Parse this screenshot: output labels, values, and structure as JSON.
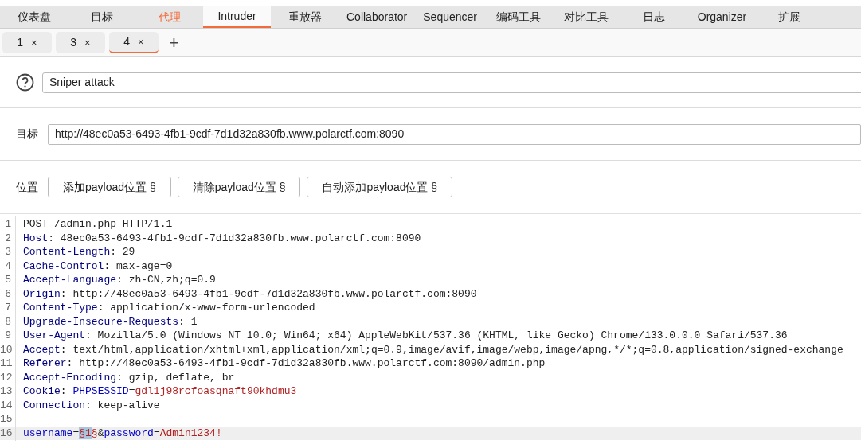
{
  "main_tabs": [
    {
      "label": "仪表盘",
      "selected": false,
      "highlighted": false
    },
    {
      "label": "目标",
      "selected": false,
      "highlighted": false
    },
    {
      "label": "代理",
      "selected": false,
      "highlighted": true
    },
    {
      "label": "Intruder",
      "selected": true,
      "highlighted": false
    },
    {
      "label": "重放器",
      "selected": false,
      "highlighted": false
    },
    {
      "label": "Collaborator",
      "selected": false,
      "highlighted": false
    },
    {
      "label": "Sequencer",
      "selected": false,
      "highlighted": false
    },
    {
      "label": "编码工具",
      "selected": false,
      "highlighted": false
    },
    {
      "label": "对比工具",
      "selected": false,
      "highlighted": false
    },
    {
      "label": "日志",
      "selected": false,
      "highlighted": false
    },
    {
      "label": "Organizer",
      "selected": false,
      "highlighted": false
    },
    {
      "label": "扩展",
      "selected": false,
      "highlighted": false
    }
  ],
  "attack_tabs": [
    {
      "label": "1",
      "close": "×",
      "selected": false
    },
    {
      "label": "3",
      "close": "×",
      "selected": false
    },
    {
      "label": "4",
      "close": "×",
      "selected": true
    }
  ],
  "add_tab": "+",
  "attack_type": {
    "value": "Sniper attack"
  },
  "target": {
    "label": "目标",
    "value": "http://48ec0a53-6493-4fb1-9cdf-7d1d32a830fb.www.polarctf.com:8090"
  },
  "positions": {
    "label": "位置",
    "buttons": [
      "添加payload位置 §",
      "清除payload位置 §",
      "自动添加payload位置 §"
    ]
  },
  "editor_lines": [
    {
      "number": "1",
      "current": false,
      "segments": [
        {
          "kind": "plain",
          "text": "POST /admin.php HTTP/1.1"
        }
      ]
    },
    {
      "number": "2",
      "current": false,
      "segments": [
        {
          "kind": "key",
          "text": "Host"
        },
        {
          "kind": "plain",
          "text": ": 48ec0a53-6493-4fb1-9cdf-7d1d32a830fb.www.polarctf.com:8090"
        }
      ]
    },
    {
      "number": "3",
      "current": false,
      "segments": [
        {
          "kind": "key",
          "text": "Content-Length"
        },
        {
          "kind": "plain",
          "text": ": 29"
        }
      ]
    },
    {
      "number": "4",
      "current": false,
      "segments": [
        {
          "kind": "key",
          "text": "Cache-Control"
        },
        {
          "kind": "plain",
          "text": ": max-age=0"
        }
      ]
    },
    {
      "number": "5",
      "current": false,
      "segments": [
        {
          "kind": "key",
          "text": "Accept-Language"
        },
        {
          "kind": "plain",
          "text": ": zh-CN,zh;q=0.9"
        }
      ]
    },
    {
      "number": "6",
      "current": false,
      "segments": [
        {
          "kind": "key",
          "text": "Origin"
        },
        {
          "kind": "plain",
          "text": ": http://48ec0a53-6493-4fb1-9cdf-7d1d32a830fb.www.polarctf.com:8090"
        }
      ]
    },
    {
      "number": "7",
      "current": false,
      "segments": [
        {
          "kind": "key",
          "text": "Content-Type"
        },
        {
          "kind": "plain",
          "text": ": application/x-www-form-urlencoded"
        }
      ]
    },
    {
      "number": "8",
      "current": false,
      "segments": [
        {
          "kind": "key",
          "text": "Upgrade-Insecure-Requests"
        },
        {
          "kind": "plain",
          "text": ": 1"
        }
      ]
    },
    {
      "number": "9",
      "current": false,
      "segments": [
        {
          "kind": "key",
          "text": "User-Agent"
        },
        {
          "kind": "plain",
          "text": ": Mozilla/5.0 (Windows NT 10.0; Win64; x64) AppleWebKit/537.36 (KHTML, like Gecko) Chrome/133.0.0.0 Safari/537.36"
        }
      ]
    },
    {
      "number": "10",
      "current": false,
      "segments": [
        {
          "kind": "key",
          "text": "Accept"
        },
        {
          "kind": "plain",
          "text": ": text/html,application/xhtml+xml,application/xml;q=0.9,image/avif,image/webp,image/apng,*/*;q=0.8,application/signed-exchange"
        }
      ]
    },
    {
      "number": "11",
      "current": false,
      "segments": [
        {
          "kind": "key",
          "text": "Referer"
        },
        {
          "kind": "plain",
          "text": ": http://48ec0a53-6493-4fb1-9cdf-7d1d32a830fb.www.polarctf.com:8090/admin.php"
        }
      ]
    },
    {
      "number": "12",
      "current": false,
      "segments": [
        {
          "kind": "key",
          "text": "Accept-Encoding"
        },
        {
          "kind": "plain",
          "text": ": gzip, deflate, br"
        }
      ]
    },
    {
      "number": "13",
      "current": false,
      "segments": [
        {
          "kind": "key",
          "text": "Cookie"
        },
        {
          "kind": "plain",
          "text": ": "
        },
        {
          "kind": "param",
          "text": "PHPSESSID"
        },
        {
          "kind": "plain",
          "text": "="
        },
        {
          "kind": "value",
          "text": "gdl1j98rcfoasqnaft90khdmu3"
        }
      ]
    },
    {
      "number": "14",
      "current": false,
      "segments": [
        {
          "kind": "key",
          "text": "Connection"
        },
        {
          "kind": "plain",
          "text": ": keep-alive"
        }
      ]
    },
    {
      "number": "15",
      "current": false
    },
    {
      "number": "16",
      "current": true,
      "segments": [
        {
          "kind": "param",
          "text": "username"
        },
        {
          "kind": "plain",
          "text": "="
        },
        {
          "kind": "selected_value",
          "text": "§1"
        },
        {
          "kind": "value",
          "text": "§"
        },
        {
          "kind": "plain",
          "text": "&"
        },
        {
          "kind": "param",
          "text": "password"
        },
        {
          "kind": "plain",
          "text": "="
        },
        {
          "kind": "value",
          "text": "Admin1234!"
        }
      ]
    }
  ]
}
